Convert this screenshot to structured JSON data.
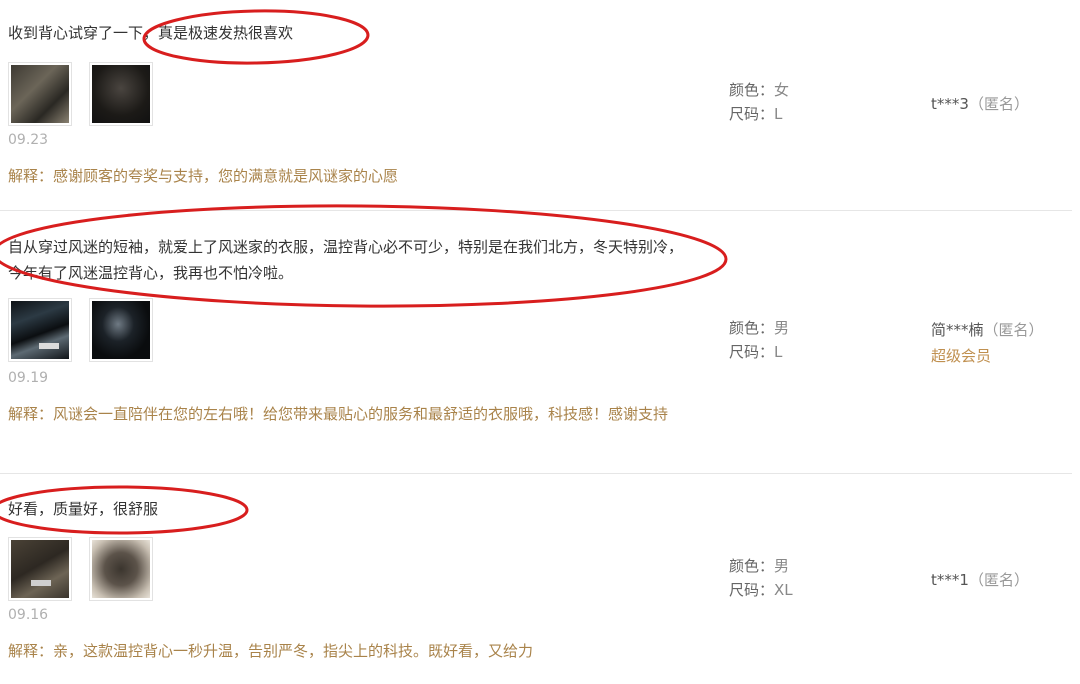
{
  "accent_color": "#a9834a",
  "highlight_color": "#d81e1e",
  "reviews": [
    {
      "content": "收到背心试穿了一下，真是极速发热很喜欢",
      "date": "09.23",
      "reply": "解释：感谢顾客的夸奖与支持，您的满意就是风谜家的心愿",
      "color_label": "颜色：",
      "color_value": "女",
      "size_label": "尺码：",
      "size_value": "L",
      "user_name": "t***3",
      "user_anon": "（匿名）",
      "user_level": ""
    },
    {
      "content": "自从穿过风迷的短袖，就爱上了风迷家的衣服，温控背心必不可少，特别是在我们北方，冬天特别冷，今年有了风迷温控背心，我再也不怕冷啦。",
      "date": "09.19",
      "reply": "解释：风谜会一直陪伴在您的左右哦！给您带来最贴心的服务和最舒适的衣服哦，科技感！感谢支持",
      "color_label": "颜色：",
      "color_value": "男",
      "size_label": "尺码：",
      "size_value": "L",
      "user_name": "简***楠",
      "user_anon": "（匿名）",
      "user_level": "超级会员"
    },
    {
      "content": "好看，质量好，很舒服",
      "date": "09.16",
      "reply": "解释：亲，这款温控背心一秒升温，告别严冬，指尖上的科技。既好看，又给力",
      "color_label": "颜色：",
      "color_value": "男",
      "size_label": "尺码：",
      "size_value": "XL",
      "user_name": "t***1",
      "user_anon": "（匿名）",
      "user_level": ""
    }
  ]
}
